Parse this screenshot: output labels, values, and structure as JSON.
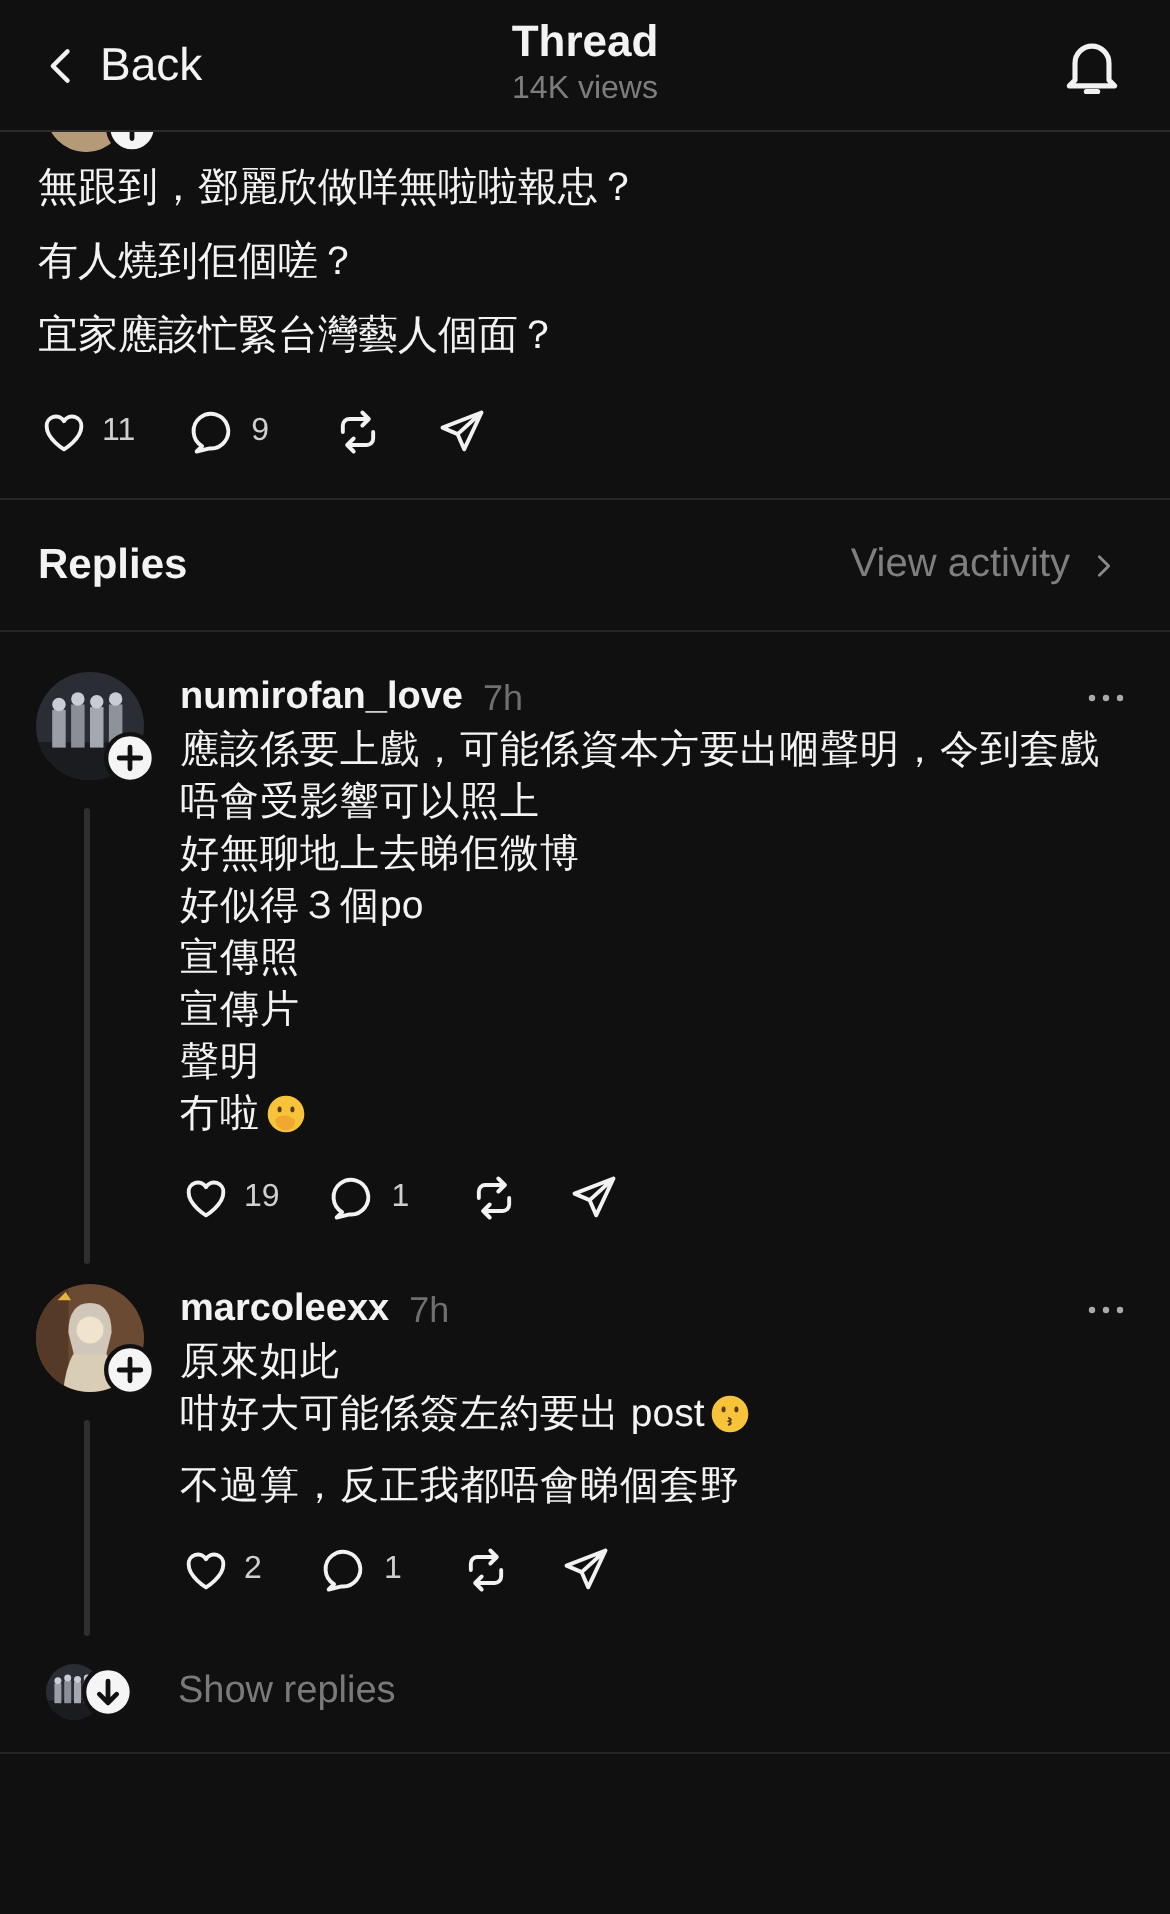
{
  "header": {
    "back": "Back",
    "title": "Thread",
    "views": "14K views"
  },
  "post": {
    "lines": [
      "無跟到，鄧麗欣做咩無啦啦報忠？",
      "有人燒到佢個嗟？",
      "宜家應該忙緊台灣藝人個面？"
    ],
    "likes": "11",
    "comments": "9"
  },
  "replies_bar": {
    "title": "Replies",
    "link": "View activity"
  },
  "comments": [
    {
      "user": "numirofan_love",
      "time": "7h",
      "avatar": {
        "kind": "group"
      },
      "paragraphs": [
        [
          {
            "text": "應該係要上戲，可能係資本方要出嗰聲明，令到套戲唔會受影響可以照上"
          },
          {
            "text": "好無聊地上去睇佢微博"
          },
          {
            "text": "好似得３個po"
          },
          {
            "text": "宣傳照"
          },
          {
            "text": "宣傳片"
          },
          {
            "text": "聲明"
          },
          {
            "text": "冇啦",
            "emoji": {
              "kind": "hand-over-mouth"
            }
          }
        ]
      ],
      "likes": "19",
      "comments": "1"
    },
    {
      "user": "marcoleexx",
      "time": "7h",
      "avatar": {
        "kind": "figure"
      },
      "paragraphs": [
        [
          {
            "text": "原來如此"
          },
          {
            "text": "咁好大可能係簽左約要出 post",
            "emoji": {
              "kind": "kissing"
            }
          }
        ],
        [
          {
            "text": "不過算，反正我都唔會睇個套野"
          }
        ]
      ],
      "likes": "2",
      "comments": "1"
    }
  ],
  "show_replies": "Show replies"
}
